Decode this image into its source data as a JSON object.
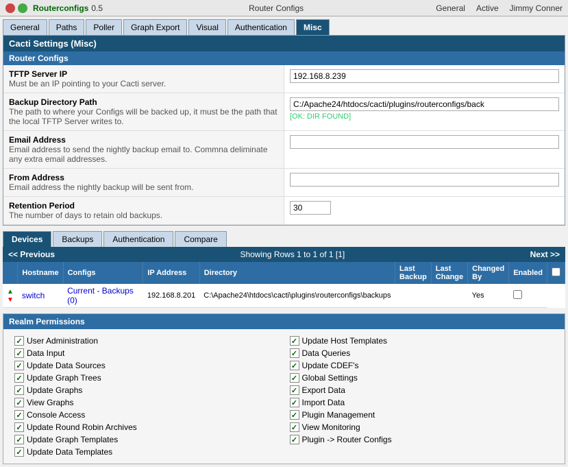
{
  "topbar": {
    "logo_label": "Routerconfigs",
    "version": "0.5",
    "title": "Router Configs",
    "status": "Active",
    "general": "General",
    "user": "Jimmy Conner"
  },
  "tabs": [
    {
      "label": "General",
      "active": false
    },
    {
      "label": "Paths",
      "active": false
    },
    {
      "label": "Poller",
      "active": false
    },
    {
      "label": "Graph Export",
      "active": false
    },
    {
      "label": "Visual",
      "active": false
    },
    {
      "label": "Authentication",
      "active": false
    },
    {
      "label": "Misc",
      "active": true
    }
  ],
  "settings_panel": {
    "title": "Cacti Settings (Misc)",
    "section": "Router Configs",
    "rows": [
      {
        "label": "TFTP Server IP",
        "description": "Must be an IP pointing to your Cacti server.",
        "value": "192.168.8.239",
        "ok_text": ""
      },
      {
        "label": "Backup Directory Path",
        "description": "The path to where your Configs will be backed up, it must be the path that the local TFTP Server writes to.",
        "value": "C:/Apache24/htdocs/cacti/plugins/routerconfigs/back",
        "ok_text": "[OK: DIR FOUND]"
      },
      {
        "label": "Email Address",
        "description": "Email address to send the nightly backup email to. Commna deliminate any extra email addresses.",
        "value": "",
        "ok_text": ""
      },
      {
        "label": "From Address",
        "description": "Email address the nightly backup will be sent from.",
        "value": "",
        "ok_text": ""
      },
      {
        "label": "Retention Period",
        "description": "The number of days to retain old backups.",
        "value": "30",
        "ok_text": "",
        "small": true
      }
    ]
  },
  "bottom_tabs": [
    {
      "label": "Devices",
      "active": true
    },
    {
      "label": "Backups",
      "active": false
    },
    {
      "label": "Authentication",
      "active": false
    },
    {
      "label": "Compare",
      "active": false
    }
  ],
  "pagination": {
    "prev": "<< Previous",
    "info": "Showing Rows 1 to 1 of 1 [1]",
    "next": "Next >>"
  },
  "table": {
    "headers": [
      "Hostname",
      "Configs",
      "IP Address",
      "Directory",
      "Last Backup",
      "Last Change",
      "Changed By",
      "Enabled"
    ],
    "rows": [
      {
        "hostname": "switch",
        "configs": "Current - Backups (0)",
        "ip": "192.168.8.201",
        "directory": "C:\\Apache24\\htdocs\\cacti\\plugins\\routerconfigs\\backups",
        "last_backup": "",
        "last_change": "",
        "changed_by": "Yes",
        "enabled": false
      }
    ]
  },
  "realm": {
    "title": "Realm Permissions",
    "left_items": [
      {
        "label": "User Administration",
        "checked": true
      },
      {
        "label": "Data Input",
        "checked": true
      },
      {
        "label": "Update Data Sources",
        "checked": true
      },
      {
        "label": "Update Graph Trees",
        "checked": true
      },
      {
        "label": "Update Graphs",
        "checked": true
      },
      {
        "label": "View Graphs",
        "checked": true
      },
      {
        "label": "Console Access",
        "checked": true
      },
      {
        "label": "Update Round Robin Archives",
        "checked": true
      },
      {
        "label": "Update Graph Templates",
        "checked": true
      },
      {
        "label": "Update Data Templates",
        "checked": true
      }
    ],
    "right_items": [
      {
        "label": "Update Host Templates",
        "checked": true
      },
      {
        "label": "Data Queries",
        "checked": true
      },
      {
        "label": "Update CDEF's",
        "checked": true
      },
      {
        "label": "Global Settings",
        "checked": true
      },
      {
        "label": "Export Data",
        "checked": true
      },
      {
        "label": "Import Data",
        "checked": true
      },
      {
        "label": "Plugin Management",
        "checked": true
      },
      {
        "label": "View Monitoring",
        "checked": true
      },
      {
        "label": "Plugin -> Router Configs",
        "checked": true
      }
    ]
  }
}
